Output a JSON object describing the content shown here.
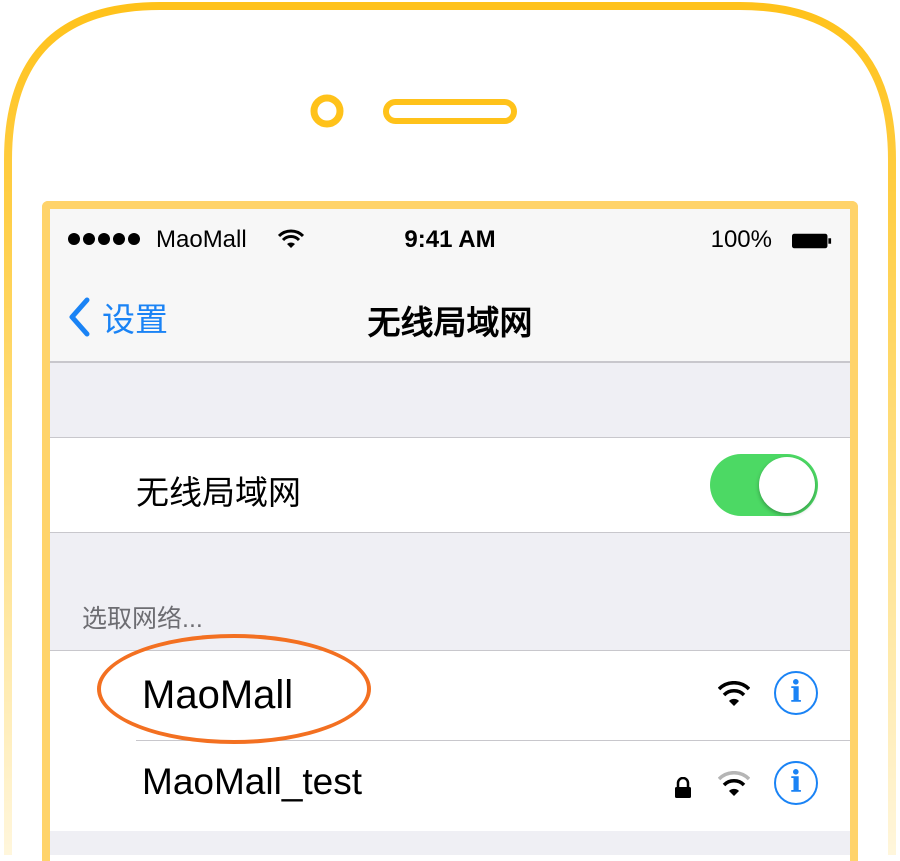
{
  "statusbar": {
    "carrier": "MaoMall",
    "time": "9:41 AM",
    "battery": "100%"
  },
  "navbar": {
    "back_label": "设置",
    "title": "无线局域网"
  },
  "wifi_toggle": {
    "label": "无线局域网",
    "state": "on"
  },
  "networks_section": {
    "header": "选取网络..."
  },
  "networks": [
    {
      "name": "MaoMall",
      "secured": false,
      "info_icon": "i"
    },
    {
      "name": "MaoMall_test",
      "secured": true,
      "info_icon": "i"
    }
  ],
  "colors": {
    "accent": "#1a83f5",
    "toggle_on": "#4cd964",
    "phone_frame": "#ffc21a",
    "highlight": "#f37021"
  }
}
